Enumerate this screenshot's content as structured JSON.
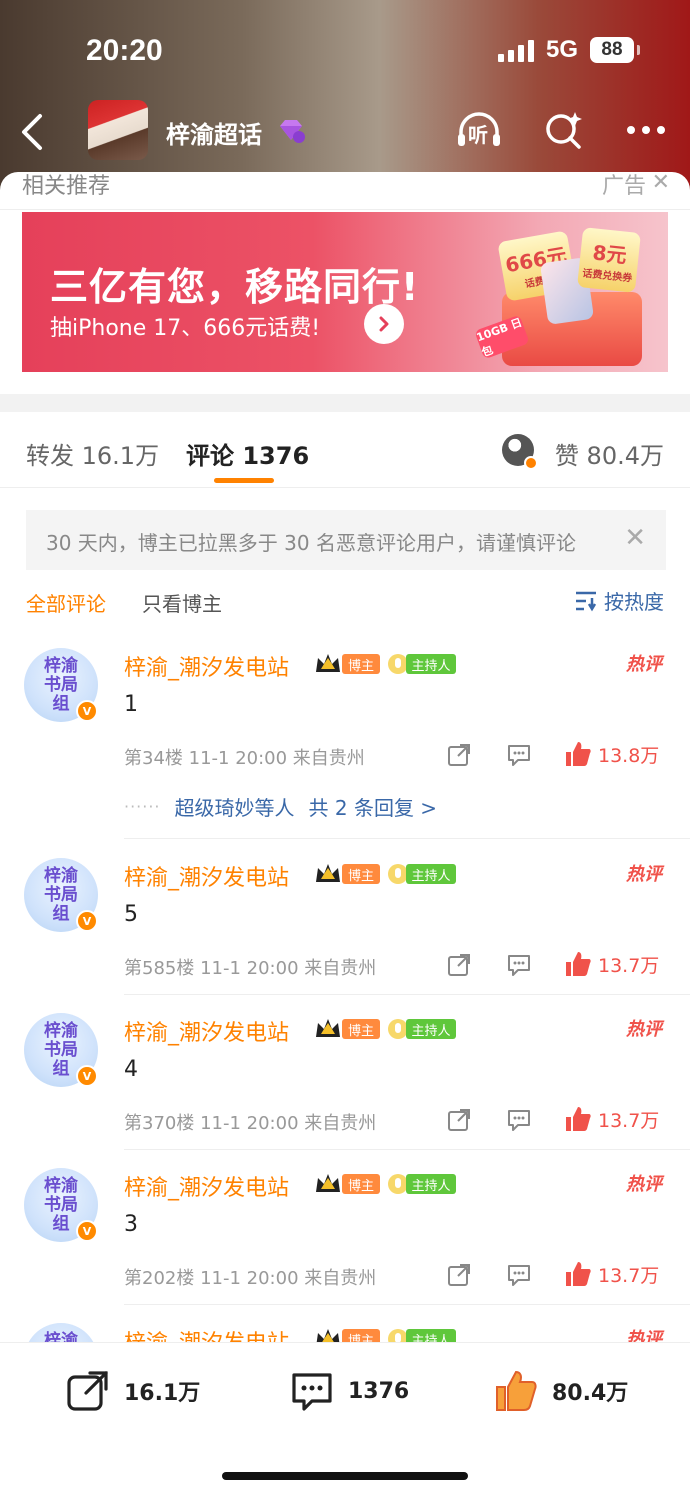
{
  "status_bar": {
    "time": "20:20",
    "network": "5G",
    "battery": "88"
  },
  "header": {
    "topic_title": "梓渝超话",
    "icons": [
      "back-arrow-icon",
      "gem-icon",
      "listen-icon",
      "search-sparkle-icon",
      "more-icon"
    ],
    "listen_label": "听"
  },
  "recommend": {
    "label": "相关推荐",
    "ad_label": "广告",
    "close": "✕"
  },
  "banner": {
    "title": "三亿有您，移路同行!",
    "subtitle": "抽iPhone 17、666元话费!",
    "prize_big": "666元",
    "prize_big_sub": "话费券",
    "prize_small": "8元",
    "prize_small_sub": "话费兑换券",
    "prize_tag": "10GB 日包",
    "colors": {
      "start": "#e5405a",
      "end": "#f6c4cc"
    }
  },
  "tabs": {
    "repost_label": "转发 16.1万",
    "comments_label": "评论 1376",
    "likes_label": "赞 80.4万"
  },
  "notice": {
    "text": "30 天内，博主已拉黑多于 30 名恶意评论用户，请谨慎评论",
    "close": "✕"
  },
  "filters": {
    "all": "全部评论",
    "host_only": "只看博主",
    "sort": "按热度"
  },
  "comments": [
    {
      "avatar_text": "梓渝书局组",
      "name": "梓渝_潮汐发电站",
      "badge_host": "博主",
      "badge_mc": "主持人",
      "hot": "热评",
      "text": "1",
      "meta": "第34楼 11-1 20:00 来自贵州",
      "likes": "13.8万",
      "reply_names": "超级琦妙等人",
      "reply_count": "共 2 条回复 >"
    },
    {
      "avatar_text": "梓渝书局组",
      "name": "梓渝_潮汐发电站",
      "badge_host": "博主",
      "badge_mc": "主持人",
      "hot": "热评",
      "text": "5",
      "meta": "第585楼 11-1 20:00 来自贵州",
      "likes": "13.7万"
    },
    {
      "avatar_text": "梓渝书局组",
      "name": "梓渝_潮汐发电站",
      "badge_host": "博主",
      "badge_mc": "主持人",
      "hot": "热评",
      "text": "4",
      "meta": "第370楼 11-1 20:00 来自贵州",
      "likes": "13.7万"
    },
    {
      "avatar_text": "梓渝书局组",
      "name": "梓渝_潮汐发电站",
      "badge_host": "博主",
      "badge_mc": "主持人",
      "hot": "热评",
      "text": "3",
      "meta": "第202楼 11-1 20:00 来自贵州",
      "likes": "13.7万"
    },
    {
      "avatar_text": "梓渝书局组",
      "name": "梓渝_潮汐发电站",
      "badge_host": "博主",
      "badge_mc": "主持人",
      "hot": "热评"
    }
  ],
  "bottom_bar": {
    "repost_count": "16.1万",
    "comment_count": "1376",
    "like_count": "80.4万"
  },
  "colors": {
    "accent": "#ff8200",
    "link": "#3a68a8",
    "hot": "#f0524a"
  }
}
